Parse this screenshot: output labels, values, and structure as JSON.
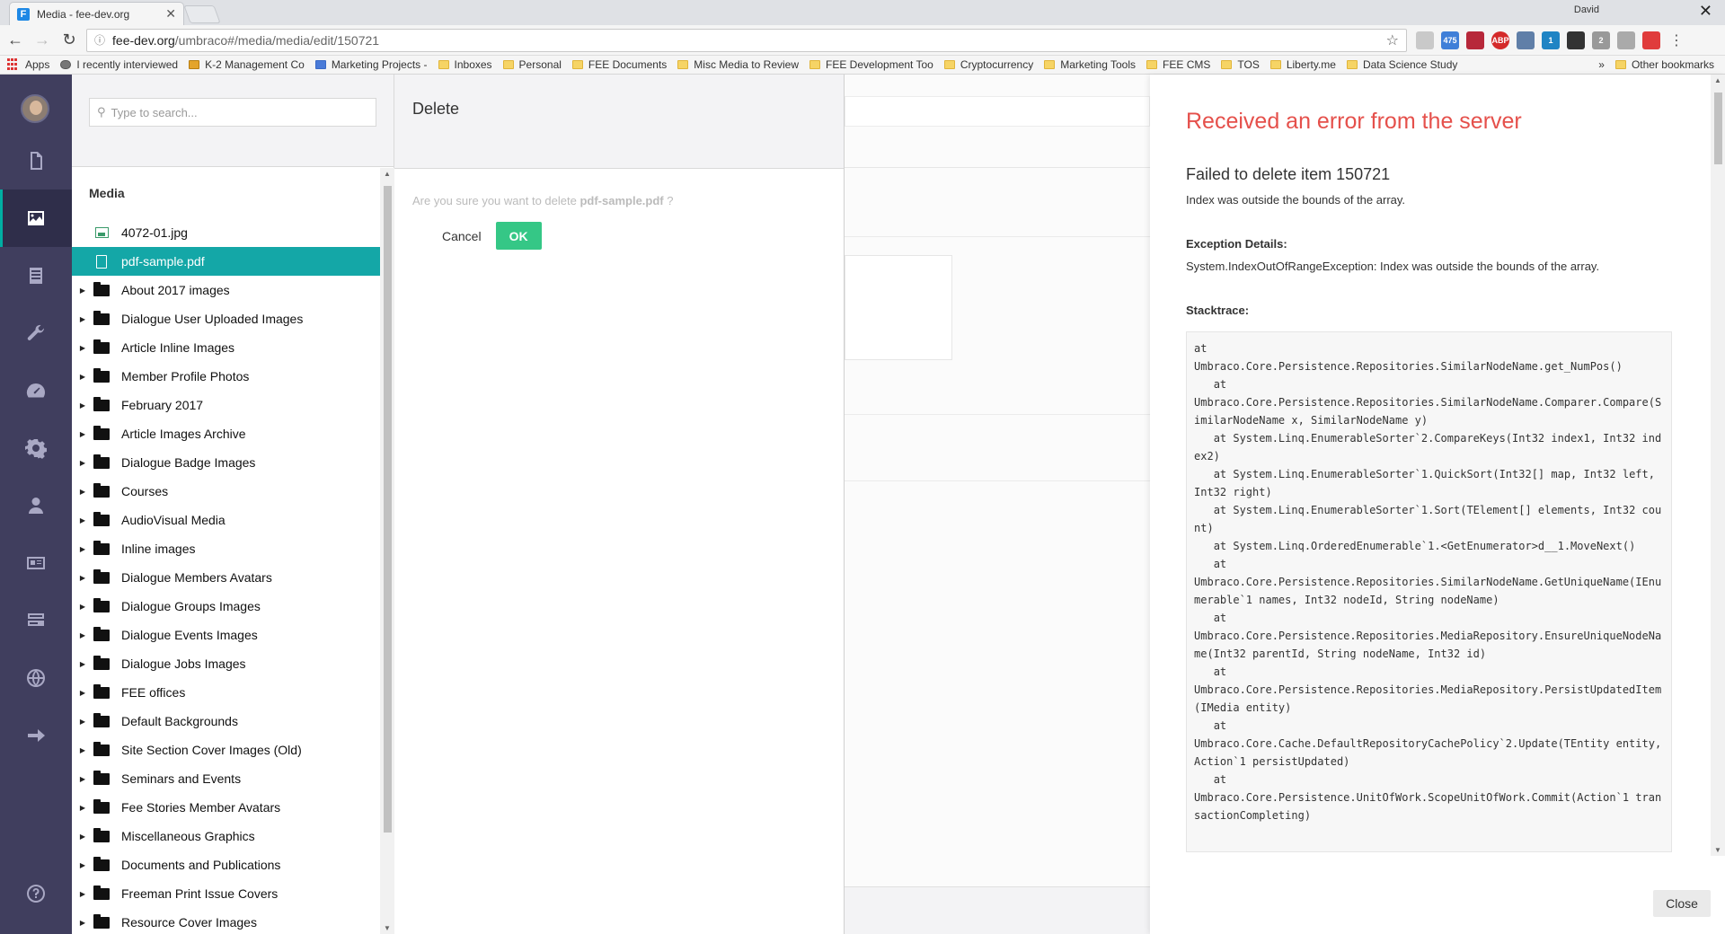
{
  "browser": {
    "tab_title": "Media - fee-dev.org",
    "tab_favicon": "F",
    "profile_name": "David",
    "url_host": "fee-dev.org",
    "url_path": "/umbraco#/media/media/edit/150721",
    "extension_badges": [
      "",
      "475",
      "",
      "ABP",
      "",
      "1",
      "",
      "2",
      "",
      ""
    ],
    "bookmarks": [
      {
        "label": "Apps",
        "icon": "apps"
      },
      {
        "label": "I recently interviewed",
        "icon": "cloud"
      },
      {
        "label": "K-2 Management Co",
        "icon": "box"
      },
      {
        "label": "Marketing Projects - ",
        "icon": "page"
      },
      {
        "label": "Inboxes",
        "icon": "folder"
      },
      {
        "label": "Personal",
        "icon": "folder"
      },
      {
        "label": "FEE Documents",
        "icon": "folder"
      },
      {
        "label": "Misc Media to Review",
        "icon": "folder"
      },
      {
        "label": "FEE Development Too",
        "icon": "folder"
      },
      {
        "label": "Cryptocurrency",
        "icon": "folder"
      },
      {
        "label": "Marketing Tools",
        "icon": "folder"
      },
      {
        "label": "FEE CMS",
        "icon": "folder"
      },
      {
        "label": "TOS",
        "icon": "folder"
      },
      {
        "label": "Liberty.me",
        "icon": "folder"
      },
      {
        "label": "Data Science Study",
        "icon": "folder"
      }
    ],
    "bookmarks_overflow": "»",
    "other_bookmarks": "Other bookmarks"
  },
  "nav": {
    "items": [
      {
        "name": "content",
        "icon": "document-icon"
      },
      {
        "name": "media",
        "icon": "image-icon",
        "active": true
      },
      {
        "name": "forms",
        "icon": "form-icon"
      },
      {
        "name": "developer",
        "icon": "wrench-icon"
      },
      {
        "name": "dashboard",
        "icon": "gauge-icon"
      },
      {
        "name": "settings",
        "icon": "gear-icon"
      },
      {
        "name": "users",
        "icon": "user-icon"
      },
      {
        "name": "members",
        "icon": "id-card-icon"
      },
      {
        "name": "redirects",
        "icon": "server-icon"
      },
      {
        "name": "translation",
        "icon": "globe-icon"
      },
      {
        "name": "deploy",
        "icon": "arrow-right-icon"
      },
      {
        "name": "help",
        "icon": "question-icon"
      }
    ]
  },
  "tree": {
    "search_placeholder": "Type to search...",
    "root_label": "Media",
    "items": [
      {
        "label": "4072-01.jpg",
        "type": "image"
      },
      {
        "label": "pdf-sample.pdf",
        "type": "file",
        "selected": true
      },
      {
        "label": "About 2017 images",
        "type": "folder"
      },
      {
        "label": "Dialogue User Uploaded Images",
        "type": "folder"
      },
      {
        "label": "Article Inline Images",
        "type": "folder"
      },
      {
        "label": "Member Profile Photos",
        "type": "folder"
      },
      {
        "label": "February 2017",
        "type": "folder"
      },
      {
        "label": "Article Images Archive",
        "type": "folder"
      },
      {
        "label": "Dialogue Badge Images",
        "type": "folder"
      },
      {
        "label": "Courses",
        "type": "folder"
      },
      {
        "label": "AudioVisual Media",
        "type": "folder"
      },
      {
        "label": "Inline images",
        "type": "folder"
      },
      {
        "label": "Dialogue Members Avatars",
        "type": "folder"
      },
      {
        "label": "Dialogue Groups Images",
        "type": "folder"
      },
      {
        "label": "Dialogue Events Images",
        "type": "folder"
      },
      {
        "label": "Dialogue Jobs Images",
        "type": "folder"
      },
      {
        "label": "FEE offices",
        "type": "folder"
      },
      {
        "label": "Default Backgrounds",
        "type": "folder"
      },
      {
        "label": "Site Section Cover Images (Old)",
        "type": "folder"
      },
      {
        "label": "Seminars and Events",
        "type": "folder"
      },
      {
        "label": "Fee Stories Member Avatars",
        "type": "folder"
      },
      {
        "label": "Miscellaneous Graphics",
        "type": "folder"
      },
      {
        "label": "Documents and Publications",
        "type": "folder"
      },
      {
        "label": "Freeman Print Issue Covers",
        "type": "folder"
      },
      {
        "label": "Resource Cover Images",
        "type": "folder"
      }
    ]
  },
  "dialog": {
    "title": "Delete",
    "message_prefix": "Are you sure you want to delete ",
    "item_name": "pdf-sample.pdf",
    "message_suffix": " ?",
    "cancel_label": "Cancel",
    "ok_label": "OK"
  },
  "error": {
    "heading": "Received an error from the server",
    "subheading": "Failed to delete item 150721",
    "message": "Index was outside the bounds of the array.",
    "exception_label": "Exception Details:",
    "exception_text": "System.IndexOutOfRangeException: Index was outside the bounds of the array.",
    "stacktrace_label": "Stacktrace:",
    "stacktrace": "at\nUmbraco.Core.Persistence.Repositories.SimilarNodeName.get_NumPos()\n   at\nUmbraco.Core.Persistence.Repositories.SimilarNodeName.Comparer.Compare(SimilarNodeName x, SimilarNodeName y)\n   at System.Linq.EnumerableSorter`2.CompareKeys(Int32 index1, Int32 index2)\n   at System.Linq.EnumerableSorter`1.QuickSort(Int32[] map, Int32 left, Int32 right)\n   at System.Linq.EnumerableSorter`1.Sort(TElement[] elements, Int32 count)\n   at System.Linq.OrderedEnumerable`1.<GetEnumerator>d__1.MoveNext()\n   at\nUmbraco.Core.Persistence.Repositories.SimilarNodeName.GetUniqueName(IEnumerable`1 names, Int32 nodeId, String nodeName)\n   at\nUmbraco.Core.Persistence.Repositories.MediaRepository.EnsureUniqueNodeName(Int32 parentId, String nodeName, Int32 id)\n   at\nUmbraco.Core.Persistence.Repositories.MediaRepository.PersistUpdatedItem(IMedia entity)\n   at\nUmbraco.Core.Cache.DefaultRepositoryCachePolicy`2.Update(TEntity entity, Action`1 persistUpdated)\n   at\nUmbraco.Core.Persistence.UnitOfWork.ScopeUnitOfWork.Commit(Action`1 transactionCompleting)",
    "close_label": "Close",
    "heading_color": "#e5504b"
  },
  "colors": {
    "nav_bg": "#403e5e",
    "selected_row": "#14a7a7",
    "ok_button": "#35c786"
  }
}
